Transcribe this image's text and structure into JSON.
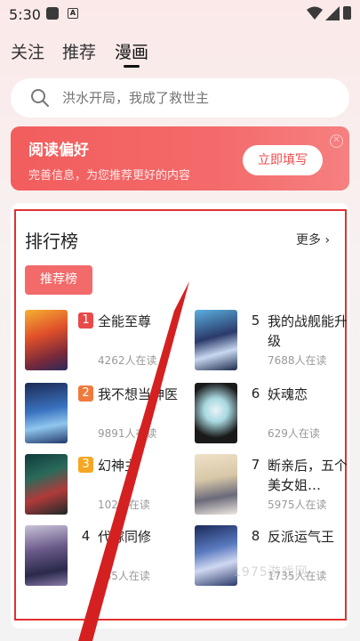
{
  "status": {
    "time": "5:30"
  },
  "tabs": [
    {
      "label": "关注"
    },
    {
      "label": "推荐"
    },
    {
      "label": "漫画"
    }
  ],
  "search": {
    "placeholder": "洪水开局，我成了救世主"
  },
  "banner": {
    "title": "阅读偏好",
    "subtitle": "完善信息，为您推荐更好的内容",
    "button": "立即填写"
  },
  "ranking": {
    "title": "排行榜",
    "more": "更多 ›",
    "chip": "推荐榜",
    "items": [
      {
        "rank": "1",
        "title": "全能至尊",
        "reads": "4262人在读"
      },
      {
        "rank": "2",
        "title": "我不想当神医",
        "reads": "9891人在读"
      },
      {
        "rank": "3",
        "title": "幻神主",
        "reads": "102人在读"
      },
      {
        "rank": "4",
        "title": "代嫁同修",
        "reads": "185人在读"
      },
      {
        "rank": "5",
        "title": "我的战舰能升级",
        "reads": "7688人在读"
      },
      {
        "rank": "6",
        "title": "妖魂恋",
        "reads": "629人在读"
      },
      {
        "rank": "7",
        "title": "断亲后，五个美女姐…",
        "reads": "5975人在读"
      },
      {
        "rank": "8",
        "title": "反派运气王",
        "reads": "1735人在读"
      }
    ]
  },
  "watermark": "1975游戏网",
  "colors": {
    "accent": "#f26a6a",
    "rank1": "#e84a4a",
    "rank2": "#f07a3c",
    "rank3": "#f5a623"
  }
}
